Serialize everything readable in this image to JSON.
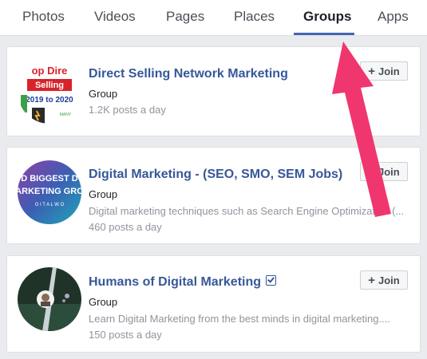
{
  "tabs": [
    {
      "label": "Photos"
    },
    {
      "label": "Videos"
    },
    {
      "label": "Pages"
    },
    {
      "label": "Places"
    },
    {
      "label": "Groups",
      "active": true
    },
    {
      "label": "Apps"
    }
  ],
  "groups": [
    {
      "name": "Direct Selling Network Marketing",
      "type": "Group",
      "description": "",
      "posts": "1.2K posts a day",
      "join_label": "Join",
      "avatar_text": [
        "op Dire",
        "Selling",
        "2019 to 2020",
        "MANY"
      ]
    },
    {
      "name": "Digital Marketing - (SEO, SMO, SEM Jobs)",
      "type": "Group",
      "description": "Digital marketing techniques such as Search Engine Optimization (...",
      "posts": "460 posts a day",
      "join_label": "Join",
      "avatar_text": [
        "D BIGGEST D",
        "ARKETING GRO",
        "G I T A L   W O"
      ]
    },
    {
      "name": "Humans of Digital Marketing",
      "type": "Group",
      "description": "Learn Digital Marketing from the best minds in digital marketing....",
      "posts": "150 posts a day",
      "join_label": "Join",
      "verified": true
    }
  ],
  "colors": {
    "accent": "#4267b2",
    "link": "#365899",
    "annotation_arrow": "#f0366f"
  }
}
